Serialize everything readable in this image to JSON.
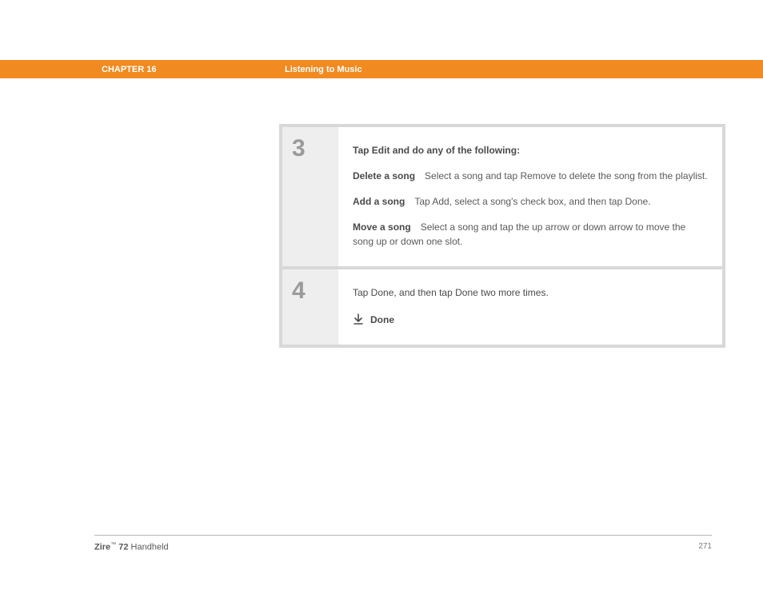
{
  "header": {
    "chapter": "CHAPTER 16",
    "breadcrumb": "Listening to Music"
  },
  "steps": [
    {
      "number": "3",
      "intro": "Tap Edit and do any of the following:",
      "items": [
        {
          "title": "Delete a song",
          "text": "Select a song and tap Remove to delete the song from the playlist."
        },
        {
          "title": "Add a song",
          "text": "Tap Add, select a song's check box, and then tap Done."
        },
        {
          "title": "Move a song",
          "text": "Select a song and tap the up arrow or down arrow to move the song up or down one slot."
        }
      ]
    },
    {
      "number": "4",
      "text": "Tap Done, and then tap Done two more times.",
      "done_label": "Done"
    }
  ],
  "footer": {
    "product_bold": "Zire",
    "product_tm": "™",
    "product_num": " 72 ",
    "product_rest": "Handheld",
    "page": "271"
  }
}
